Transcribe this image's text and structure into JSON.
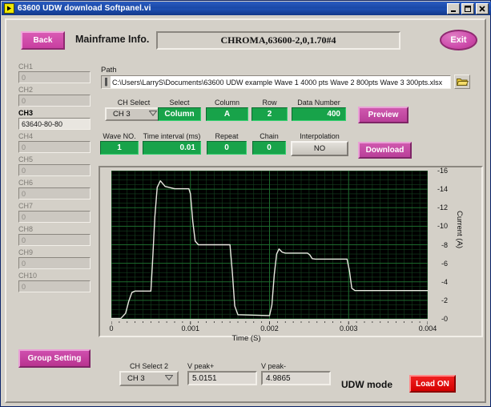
{
  "window": {
    "title": "63600 UDW download Softpanel.vi",
    "icon": "labview-vi-icon",
    "buttons": [
      {
        "name": "minimize-button",
        "glyph": "minimize-icon"
      },
      {
        "name": "maximize-button",
        "glyph": "maximize-icon"
      },
      {
        "name": "close-button",
        "glyph": "close-icon"
      }
    ]
  },
  "header": {
    "back_label": "Back",
    "mainframe_label": "Mainframe Info.",
    "mainframe_value": "CHROMA,63600-2,0,1.70#4",
    "exit_label": "Exit"
  },
  "channels": [
    {
      "label": "CH1",
      "value": "0",
      "active": false
    },
    {
      "label": "CH2",
      "value": "0",
      "active": false
    },
    {
      "label": "CH3",
      "value": "63640-80-80",
      "active": true
    },
    {
      "label": "CH4",
      "value": "0",
      "active": false
    },
    {
      "label": "CH5",
      "value": "0",
      "active": false
    },
    {
      "label": "CH6",
      "value": "0",
      "active": false
    },
    {
      "label": "CH7",
      "value": "0",
      "active": false
    },
    {
      "label": "CH8",
      "value": "0",
      "active": false
    },
    {
      "label": "CH9",
      "value": "0",
      "active": false
    },
    {
      "label": "CH10",
      "value": "0",
      "active": false
    }
  ],
  "path": {
    "label": "Path",
    "value": "C:\\Users\\LarryS\\Documents\\63600 UDW example Wave 1 4000 pts Wave 2 800pts Wave 3 300pts.xlsx",
    "browse_icon": "folder-icon"
  },
  "controls_row1": {
    "ch_select_label": "CH Select",
    "ch_select_value": "CH 3",
    "select_label": "Select",
    "select_value": "Column",
    "column_label": "Column",
    "column_value": "A",
    "row_label": "Row",
    "row_value": "2",
    "data_number_label": "Data Number",
    "data_number_value": "400",
    "preview_label": "Preview"
  },
  "controls_row2": {
    "wave_no_label": "Wave NO.",
    "wave_no_value": "1",
    "time_interval_label": "Time interval (ms)",
    "time_interval_value": "0.01",
    "repeat_label": "Repeat",
    "repeat_value": "0",
    "chain_label": "Chain",
    "chain_value": "0",
    "interpolation_label": "Interpolation",
    "interpolation_value": "NO",
    "download_label": "Download"
  },
  "footer": {
    "group_setting_label": "Group Setting",
    "ch_select2_label": "CH Select 2",
    "ch_select2_value": "CH 3",
    "vpeak_plus_label": "V peak+",
    "vpeak_plus_value": "5.0151",
    "vpeak_minus_label": "V peak-",
    "vpeak_minus_value": "4.9865",
    "udw_mode_label": "UDW mode",
    "load_label": "Load ON"
  },
  "colors": {
    "accent_pink": "#c83fa0",
    "green_field": "#18a34a",
    "load_red": "#d40000",
    "plot_bg": "#000000",
    "plot_grid": "#1d6b2e",
    "trace": "#e8e8e0",
    "panel": "#d4d0c8",
    "titlebar": "#1b4aa8"
  },
  "chart_data": {
    "type": "line",
    "title": "",
    "xlabel": "Time (S)",
    "ylabel": "Current (A)",
    "xlim": [
      0,
      0.004
    ],
    "ylim": [
      0,
      16
    ],
    "xticks": [
      "0",
      "0.001",
      "0.002",
      "0.003",
      "0.004"
    ],
    "xtick_values": [
      0,
      0.001,
      0.002,
      0.003,
      0.004
    ],
    "yticks": [
      "0",
      "2",
      "4",
      "6",
      "8",
      "10",
      "12",
      "14",
      "16"
    ],
    "ytick_values": [
      0,
      2,
      4,
      6,
      8,
      10,
      12,
      14,
      16
    ],
    "grid": true,
    "legend": "none",
    "yaxis_side": "right",
    "series": [
      {
        "name": "Current",
        "color": "#e8e8e0",
        "x": [
          0,
          0.00012,
          0.00018,
          0.00022,
          0.00026,
          0.0003,
          0.0005,
          0.00052,
          0.00055,
          0.00058,
          0.00062,
          0.00068,
          0.0008,
          0.00098,
          0.001,
          0.00103,
          0.00106,
          0.0011,
          0.0015,
          0.00153,
          0.00156,
          0.0016,
          0.002,
          0.00203,
          0.00206,
          0.00209,
          0.00212,
          0.00216,
          0.0022,
          0.00248,
          0.00251,
          0.00254,
          0.00258,
          0.00298,
          0.00301,
          0.00304,
          0.00308,
          0.0034,
          0.0038,
          0.004
        ],
        "y": [
          0.05,
          0.05,
          0.6,
          1.9,
          2.85,
          3.0,
          3.0,
          6.0,
          11.0,
          14.2,
          14.9,
          14.3,
          14.05,
          14.05,
          13.5,
          10.5,
          8.4,
          8.0,
          8.0,
          5.0,
          1.4,
          0.45,
          0.35,
          1.5,
          4.8,
          7.0,
          7.55,
          7.2,
          7.1,
          7.1,
          6.9,
          6.5,
          6.45,
          6.45,
          5.2,
          3.3,
          3.05,
          3.05,
          3.05,
          3.05
        ]
      }
    ],
    "annotations": []
  }
}
